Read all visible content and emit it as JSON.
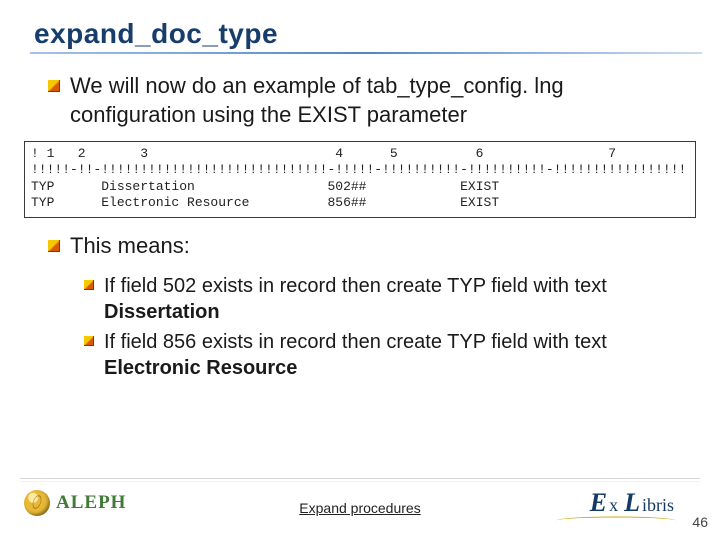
{
  "title": "expand_doc_type",
  "intro": "We will now do an example of tab_type_config. lng configuration using the EXIST parameter",
  "code": {
    "header": "! 1   2       3                        4      5          6                7",
    "ruler": "!!!!!-!!-!!!!!!!!!!!!!!!!!!!!!!!!!!!!!-!!!!!-!!!!!!!!!!-!!!!!!!!!!-!!!!!!!!!!!!!!!!!",
    "rows": [
      {
        "col1": "TYP",
        "col3": "Dissertation",
        "col4": "502##",
        "col6": "EXIST"
      },
      {
        "col1": "TYP",
        "col3": "Electronic Resource",
        "col4": "856##",
        "col6": "EXIST"
      }
    ]
  },
  "means_label": "This means:",
  "means": [
    {
      "pre": "If field 502 exists in record then create TYP field with text ",
      "bold": "Dissertation"
    },
    {
      "pre": "If field 856 exists in record then create TYP field with text ",
      "bold": "Electronic Resource"
    }
  ],
  "footer": {
    "left_brand": "ALEPH",
    "center": "Expand procedures",
    "right_brand_parts": {
      "e": "E",
      "x": "x",
      "l": "L",
      "rest": "ibris"
    },
    "page_number": "46"
  }
}
